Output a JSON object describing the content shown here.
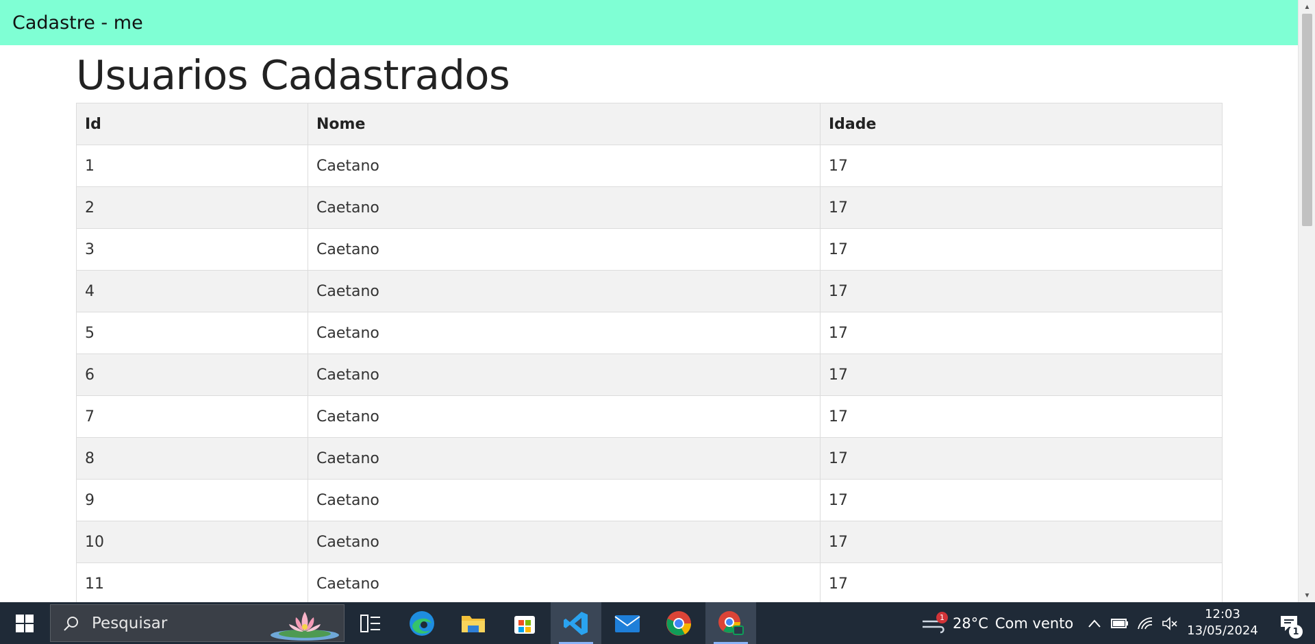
{
  "navbar": {
    "brand": "Cadastre - me"
  },
  "page": {
    "title": "Usuarios Cadastrados"
  },
  "table": {
    "headers": [
      "Id",
      "Nome",
      "Idade"
    ],
    "rows": [
      [
        "1",
        "Caetano",
        "17"
      ],
      [
        "2",
        "Caetano",
        "17"
      ],
      [
        "3",
        "Caetano",
        "17"
      ],
      [
        "4",
        "Caetano",
        "17"
      ],
      [
        "5",
        "Caetano",
        "17"
      ],
      [
        "6",
        "Caetano",
        "17"
      ],
      [
        "7",
        "Caetano",
        "17"
      ],
      [
        "8",
        "Caetano",
        "17"
      ],
      [
        "9",
        "Caetano",
        "17"
      ],
      [
        "10",
        "Caetano",
        "17"
      ],
      [
        "11",
        "Caetano",
        "17"
      ]
    ]
  },
  "taskbar": {
    "search_placeholder": "Pesquisar",
    "pinned": [
      "task-view-icon",
      "edge-icon",
      "file-explorer-icon",
      "microsoft-store-icon",
      "vscode-icon",
      "mail-icon",
      "chrome-icon",
      "chrome-profile-icon"
    ],
    "weather": {
      "temp": "28°C",
      "condition": "Com vento",
      "alert_count": "1"
    },
    "clock": {
      "time": "12:03",
      "date": "13/05/2024"
    },
    "notification_count": "1"
  },
  "colors": {
    "navbar_bg": "#7fffd4",
    "taskbar_bg": "#1f2a37",
    "row_stripe": "#f2f2f2"
  }
}
